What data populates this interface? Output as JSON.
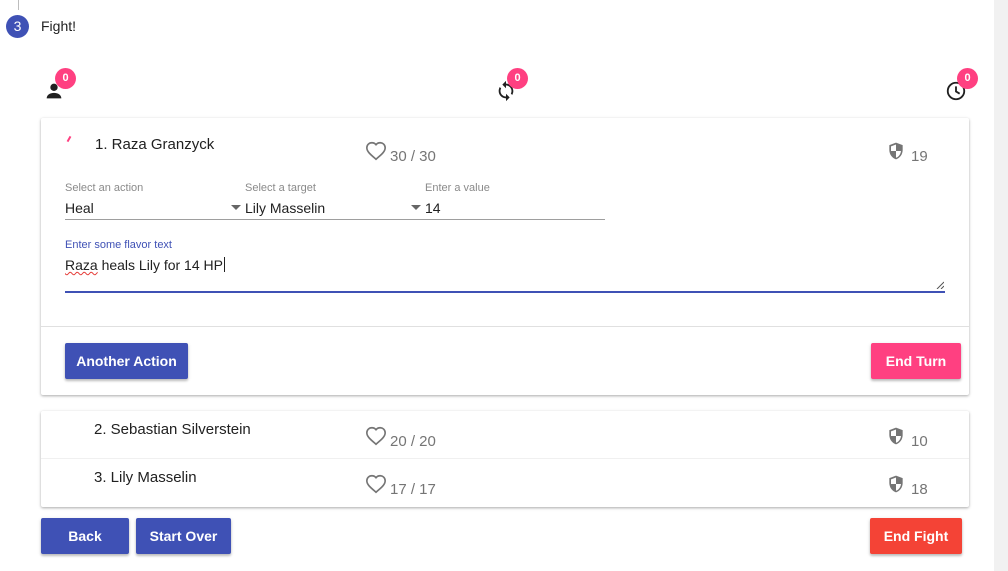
{
  "step": {
    "number": "3",
    "title": "Fight!"
  },
  "counters": [
    {
      "icon": "person-icon",
      "count": "0"
    },
    {
      "icon": "sync-icon",
      "count": "0"
    },
    {
      "icon": "clock-icon",
      "count": "0"
    }
  ],
  "active_combatant": {
    "name": "1. Raza Granzyck",
    "hp": "30 / 30",
    "ac": "19",
    "action_label": "Select an action",
    "action_value": "Heal",
    "target_label": "Select a target",
    "target_value": "Lily Masselin",
    "value_label": "Enter a value",
    "value_value": "14",
    "flavor_label": "Enter some flavor text",
    "flavor_word1": "Raza",
    "flavor_rest": " heals Lily for 14 HP",
    "another_action_label": "Another Action",
    "end_turn_label": "End Turn"
  },
  "combatants": [
    {
      "name": "2. Sebastian Silverstein",
      "hp": "20 / 20",
      "ac": "10"
    },
    {
      "name": "3. Lily Masselin",
      "hp": "17 / 17",
      "ac": "18"
    }
  ],
  "footer": {
    "back_label": "Back",
    "start_over_label": "Start Over",
    "end_fight_label": "End Fight"
  },
  "colors": {
    "primary": "#3f51b5",
    "accent": "#ff4081",
    "warn": "#f44336"
  }
}
